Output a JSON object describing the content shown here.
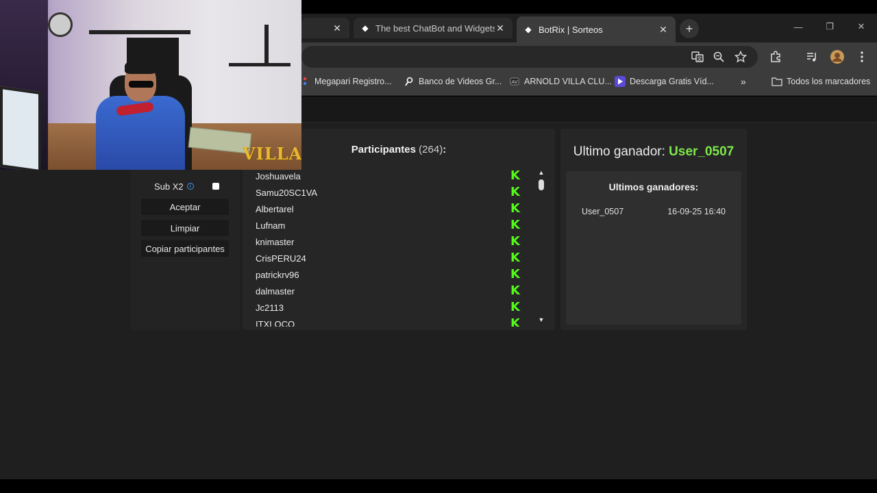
{
  "browser": {
    "tabs": [
      {
        "label": "",
        "active": false
      },
      {
        "label": "The best ChatBot and Widgets",
        "active": false
      },
      {
        "label": "BotRix | Sorteos",
        "active": true
      }
    ],
    "new_tab_symbol": "+",
    "window_controls": {
      "minimize": "—",
      "restore": "❐",
      "close": "✕"
    },
    "toolbar_icons": [
      "translate-icon",
      "zoom-icon",
      "star-icon",
      "extensions-icon",
      "media-icon",
      "profile-avatar",
      "menu-icon"
    ],
    "bookmarks": [
      {
        "label": "Megapari Registro..."
      },
      {
        "label": "Banco de Videos Gr..."
      },
      {
        "label": "ARNOLD VILLA CLU..."
      },
      {
        "label": "Descarga Gratis Víd..."
      }
    ],
    "bookmarks_overflow": "»",
    "all_bookmarks_label": "Todos los marcadores"
  },
  "options": {
    "sub_x2_label": "Sub X2",
    "sub_x2_checked": false,
    "buttons": {
      "accept": "Aceptar",
      "clear": "Limpiar",
      "copy": "Copiar participantes"
    }
  },
  "participants": {
    "title": "Participantes",
    "count": "(264)",
    "suffix": ":",
    "items": [
      "Joshuavela",
      "Samu20SC1VA",
      "Albertarel",
      "Lufnam",
      "knimaster",
      "CrisPERU24",
      "patrickrv96",
      "dalmaster",
      "Jc2113",
      "ITXLOCO"
    ],
    "platform_glyph": "K"
  },
  "winner": {
    "label": "Ultimo ganador:",
    "name": "User_0507",
    "history_title": "Ultimos ganadores:",
    "history": [
      {
        "name": "User_0507",
        "date": "16-09-25 16:40"
      }
    ]
  },
  "webcam": {
    "overlay_text": "VILLA"
  },
  "colors": {
    "accent_green": "#53fc18",
    "winner_green": "#7ee84a",
    "info_blue": "#3b8fe8"
  }
}
